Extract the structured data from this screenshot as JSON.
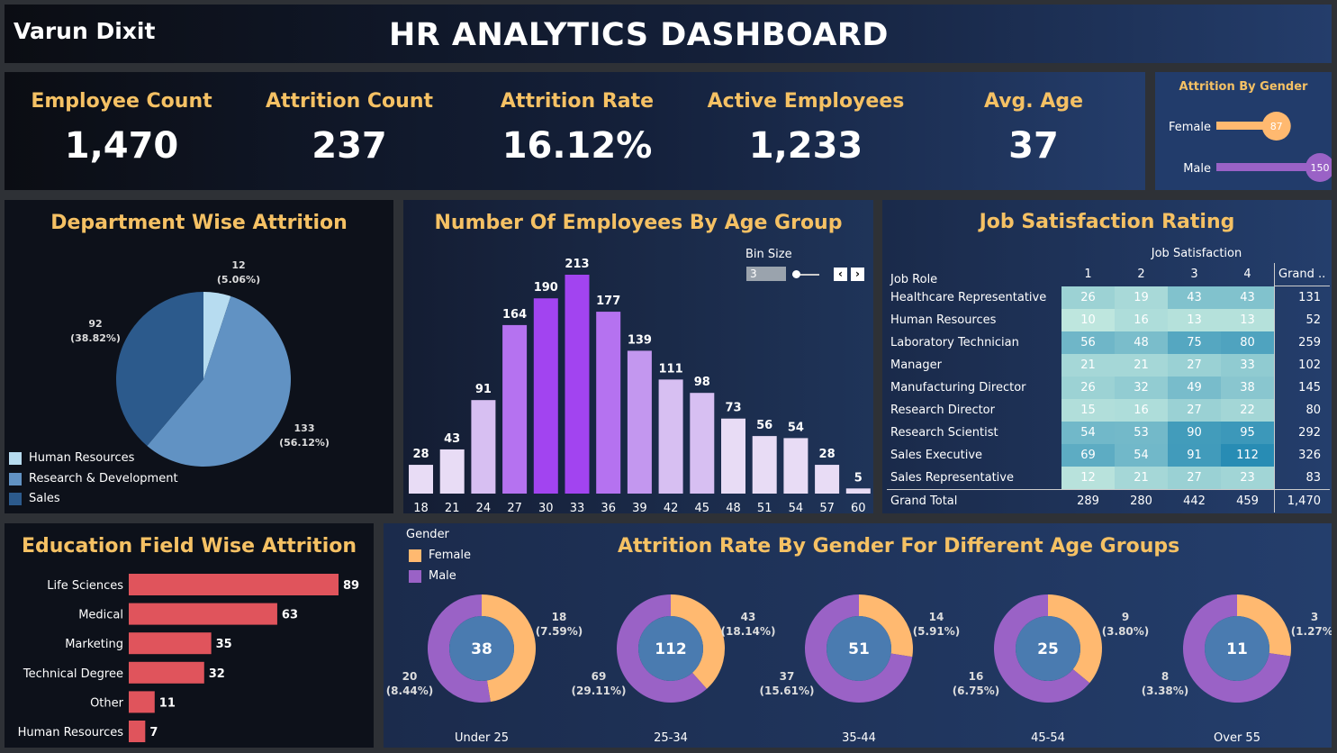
{
  "header": {
    "author": "Varun Dixit",
    "title": "HR ANALYTICS DASHBOARD"
  },
  "kpis": [
    {
      "label": "Employee Count",
      "value": "1,470"
    },
    {
      "label": "Attrition Count",
      "value": "237"
    },
    {
      "label": "Attrition Rate",
      "value": "16.12%"
    },
    {
      "label": "Active Employees",
      "value": "1,233"
    },
    {
      "label": "Avg. Age",
      "value": "37"
    }
  ],
  "colors": {
    "gold": "#f5c164",
    "female": "#ffb970",
    "male": "#9a62c6",
    "edu_bar": "#e0545c"
  },
  "chart_data": [
    {
      "id": "attrition_by_gender",
      "type": "bar",
      "title": "Attrition By Gender",
      "categories": [
        "Female",
        "Male"
      ],
      "values": [
        87,
        150
      ],
      "value_labels": [
        "87",
        "150"
      ],
      "colors": [
        "#ffb970",
        "#9a62c6"
      ]
    },
    {
      "id": "department_attrition",
      "type": "pie",
      "title": "Department Wise Attrition",
      "labels": [
        "Human Resources",
        "Research & Development",
        "Sales"
      ],
      "values": [
        12,
        133,
        92
      ],
      "value_labels": [
        "12",
        "133",
        "92"
      ],
      "pct_labels": [
        "(5.06%)",
        "(56.12%)",
        "(38.82%)"
      ],
      "colors": [
        "#b7dcf0",
        "#6192c3",
        "#2c5a8c"
      ]
    },
    {
      "id": "age_group",
      "type": "bar",
      "title": "Number Of Employees By Age Group",
      "categories": [
        "18",
        "21",
        "24",
        "27",
        "30",
        "33",
        "36",
        "39",
        "42",
        "45",
        "48",
        "51",
        "54",
        "57",
        "60"
      ],
      "values": [
        28,
        43,
        91,
        164,
        190,
        213,
        177,
        139,
        111,
        98,
        73,
        56,
        54,
        28,
        5
      ],
      "value_labels": [
        "28",
        "43",
        "91",
        "164",
        "190",
        "213",
        "177",
        "139",
        "111",
        "98",
        "73",
        "56",
        "54",
        "28",
        "5"
      ],
      "ylim": [
        0,
        213
      ],
      "bin_size_label": "Bin Size",
      "bin_size_value": "3",
      "prev_icon": "chevron-left-icon",
      "next_icon": "chevron-right-icon"
    },
    {
      "id": "job_satisfaction",
      "type": "table",
      "title": "Job Satisfaction Rating",
      "column_group": "Job Satisfaction",
      "row_header": "Job Role",
      "columns": [
        "1",
        "2",
        "3",
        "4"
      ],
      "grand_header": "Grand ..",
      "rows": [
        {
          "role": "Healthcare Representative",
          "values": [
            26,
            19,
            43,
            43
          ],
          "labels": [
            "26",
            "19",
            "43",
            "43"
          ],
          "total": "131"
        },
        {
          "role": "Human Resources",
          "values": [
            10,
            16,
            13,
            13
          ],
          "labels": [
            "10",
            "16",
            "13",
            "13"
          ],
          "total": "52"
        },
        {
          "role": "Laboratory Technician",
          "values": [
            56,
            48,
            75,
            80
          ],
          "labels": [
            "56",
            "48",
            "75",
            "80"
          ],
          "total": "259"
        },
        {
          "role": "Manager",
          "values": [
            21,
            21,
            27,
            33
          ],
          "labels": [
            "21",
            "21",
            "27",
            "33"
          ],
          "total": "102"
        },
        {
          "role": "Manufacturing Director",
          "values": [
            26,
            32,
            49,
            38
          ],
          "labels": [
            "26",
            "32",
            "49",
            "38"
          ],
          "total": "145"
        },
        {
          "role": "Research Director",
          "values": [
            15,
            16,
            27,
            22
          ],
          "labels": [
            "15",
            "16",
            "27",
            "22"
          ],
          "total": "80"
        },
        {
          "role": "Research Scientist",
          "values": [
            54,
            53,
            90,
            95
          ],
          "labels": [
            "54",
            "53",
            "90",
            "95"
          ],
          "total": "292"
        },
        {
          "role": "Sales Executive",
          "values": [
            69,
            54,
            91,
            112
          ],
          "labels": [
            "69",
            "54",
            "91",
            "112"
          ],
          "total": "326"
        },
        {
          "role": "Sales Representative",
          "values": [
            12,
            21,
            27,
            23
          ],
          "labels": [
            "12",
            "21",
            "27",
            "23"
          ],
          "total": "83"
        }
      ],
      "grand_total_label": "Grand Total",
      "grand_totals": [
        "289",
        "280",
        "442",
        "459"
      ],
      "grand_total_all": "1,470"
    },
    {
      "id": "education_attrition",
      "type": "bar",
      "orientation": "horizontal",
      "title": "Education Field Wise Attrition",
      "categories": [
        "Life Sciences",
        "Medical",
        "Marketing",
        "Technical Degree",
        "Other",
        "Human Resources"
      ],
      "values": [
        89,
        63,
        35,
        32,
        11,
        7
      ],
      "value_labels": [
        "89",
        "63",
        "35",
        "32",
        "11",
        "7"
      ]
    },
    {
      "id": "gender_age_attrition",
      "type": "pie",
      "variant": "donut",
      "title": "Attrition Rate By Gender For Different Age Groups",
      "legend_title": "Gender",
      "legend": [
        "Female",
        "Male"
      ],
      "groups": [
        {
          "label": "Under 25",
          "total": "38",
          "female": 18,
          "male": 20,
          "female_val": "18",
          "female_pct": "(7.59%)",
          "male_val": "20",
          "male_pct": "(8.44%)"
        },
        {
          "label": "25-34",
          "total": "112",
          "female": 43,
          "male": 69,
          "female_val": "43",
          "female_pct": "(18.14%)",
          "male_val": "69",
          "male_pct": "(29.11%)"
        },
        {
          "label": "35-44",
          "total": "51",
          "female": 14,
          "male": 37,
          "female_val": "14",
          "female_pct": "(5.91%)",
          "male_val": "37",
          "male_pct": "(15.61%)"
        },
        {
          "label": "45-54",
          "total": "25",
          "female": 9,
          "male": 16,
          "female_val": "9",
          "female_pct": "(3.80%)",
          "male_val": "16",
          "male_pct": "(6.75%)"
        },
        {
          "label": "Over 55",
          "total": "11",
          "female": 3,
          "male": 8,
          "female_val": "3",
          "female_pct": "(1.27%)",
          "male_val": "8",
          "male_pct": "(3.38%)"
        }
      ]
    }
  ]
}
